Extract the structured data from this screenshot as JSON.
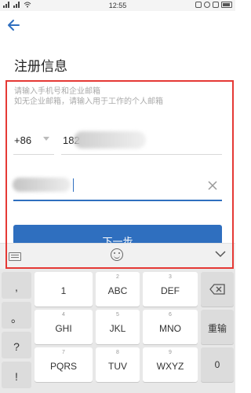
{
  "status_bar": {
    "time": "12:55"
  },
  "header": {
    "title": "注册信息"
  },
  "form": {
    "hint_line1": "请输入手机号和企业邮箱",
    "hint_line2": "如无企业邮箱，请输入用于工作的个人邮箱",
    "country_code": "+86",
    "phone_value": "182",
    "email_value": "",
    "next_button": "下一步"
  },
  "keyboard": {
    "side_keys": [
      ",",
      "。",
      "?",
      "!"
    ],
    "rows": [
      [
        {
          "num": "",
          "label": "1"
        },
        {
          "num": "2",
          "label": "ABC"
        },
        {
          "num": "3",
          "label": "DEF"
        }
      ],
      [
        {
          "num": "4",
          "label": "GHI"
        },
        {
          "num": "5",
          "label": "JKL"
        },
        {
          "num": "6",
          "label": "MNO"
        }
      ],
      [
        {
          "num": "7",
          "label": "PQRS"
        },
        {
          "num": "8",
          "label": "TUV"
        },
        {
          "num": "9",
          "label": "WXYZ"
        }
      ]
    ],
    "reset_key": "重输",
    "zero_key": "0"
  },
  "icons": [
    "back-arrow-icon",
    "keyboard-icon",
    "emoji-icon",
    "collapse-keyboard-icon",
    "clear-icon",
    "backspace-icon"
  ],
  "colors": {
    "accent": "#2f6fbf",
    "highlight": "#e53935"
  }
}
